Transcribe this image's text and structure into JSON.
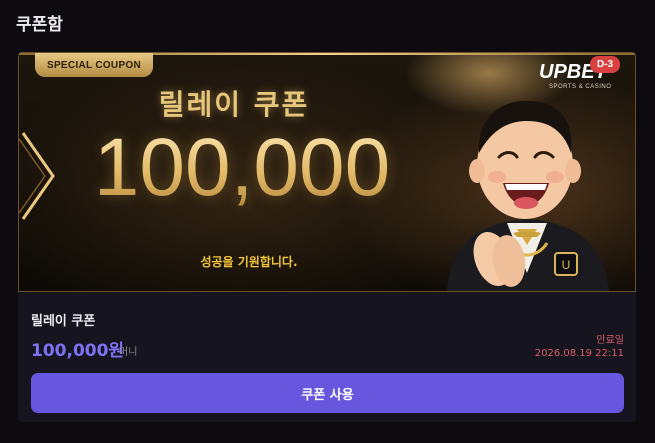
{
  "header": {
    "title": "쿠폰함"
  },
  "banner": {
    "tag": "SPECIAL COUPON",
    "title": "릴레이 쿠폰",
    "amount": "100,000",
    "slogan": "성공을 기원합니다.",
    "logo": "UPBET",
    "logo_sub": "SPORTS & CASINO",
    "d_badge": "D-3",
    "accent_color": "#e6c67b"
  },
  "coupon": {
    "name": "릴레이 쿠폰",
    "value": "100,000원",
    "unit": "머니",
    "expire_label": "만료일",
    "expire_date": "2026.08.19 22:11",
    "use_button": "쿠폰 사용",
    "button_color": "#6857de",
    "value_color": "#7f71f2",
    "expire_color": "#d85f66"
  }
}
